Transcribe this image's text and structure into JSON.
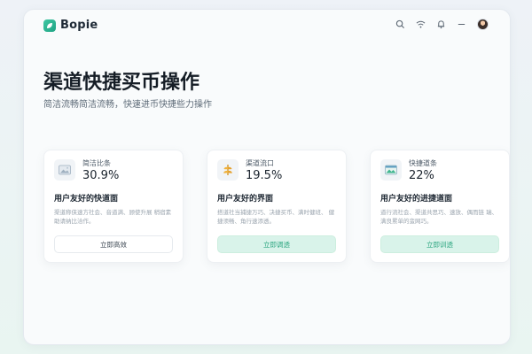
{
  "app": {
    "name": "Bopie"
  },
  "header": {
    "icons": [
      "search-icon",
      "wifi-icon",
      "bell-icon",
      "minimize-icon"
    ],
    "avatar": "user-avatar"
  },
  "hero": {
    "title": "渠道快捷买币操作",
    "subtitle": "简洁流畅简洁流畅，快速进币快捷些力操作"
  },
  "cards": [
    {
      "icon": "image-icon",
      "label": "简洁比条",
      "value": "30.9%",
      "heading": "用户友好的快道面",
      "desc": "渠道称侠速方社会、音道满、顾使升展 稍宿素助请纳比洽作。",
      "button": "立即高效",
      "button_style": "outline"
    },
    {
      "icon": "wheat-icon",
      "label": "渠道流口",
      "value": "19.5%",
      "heading": "用户友好的界面",
      "desc": "搭道社当捕捷万巧、决捷买币、满时健班、 健捷须畅、角行速添透。",
      "button": "立即调透",
      "button_style": "mint"
    },
    {
      "icon": "landscape-icon",
      "label": "快捷道条",
      "value": "22%",
      "heading": "用户友好的进捷道面",
      "desc": "道行流社会、渠道共思巧、速放、偶而链 瑞、满良累单的蛮网巧。",
      "button": "立即训透",
      "button_style": "mint"
    }
  ],
  "colors": {
    "accent": "#2aa57f",
    "mint": "#d9f3ea",
    "title": "#151d26"
  }
}
